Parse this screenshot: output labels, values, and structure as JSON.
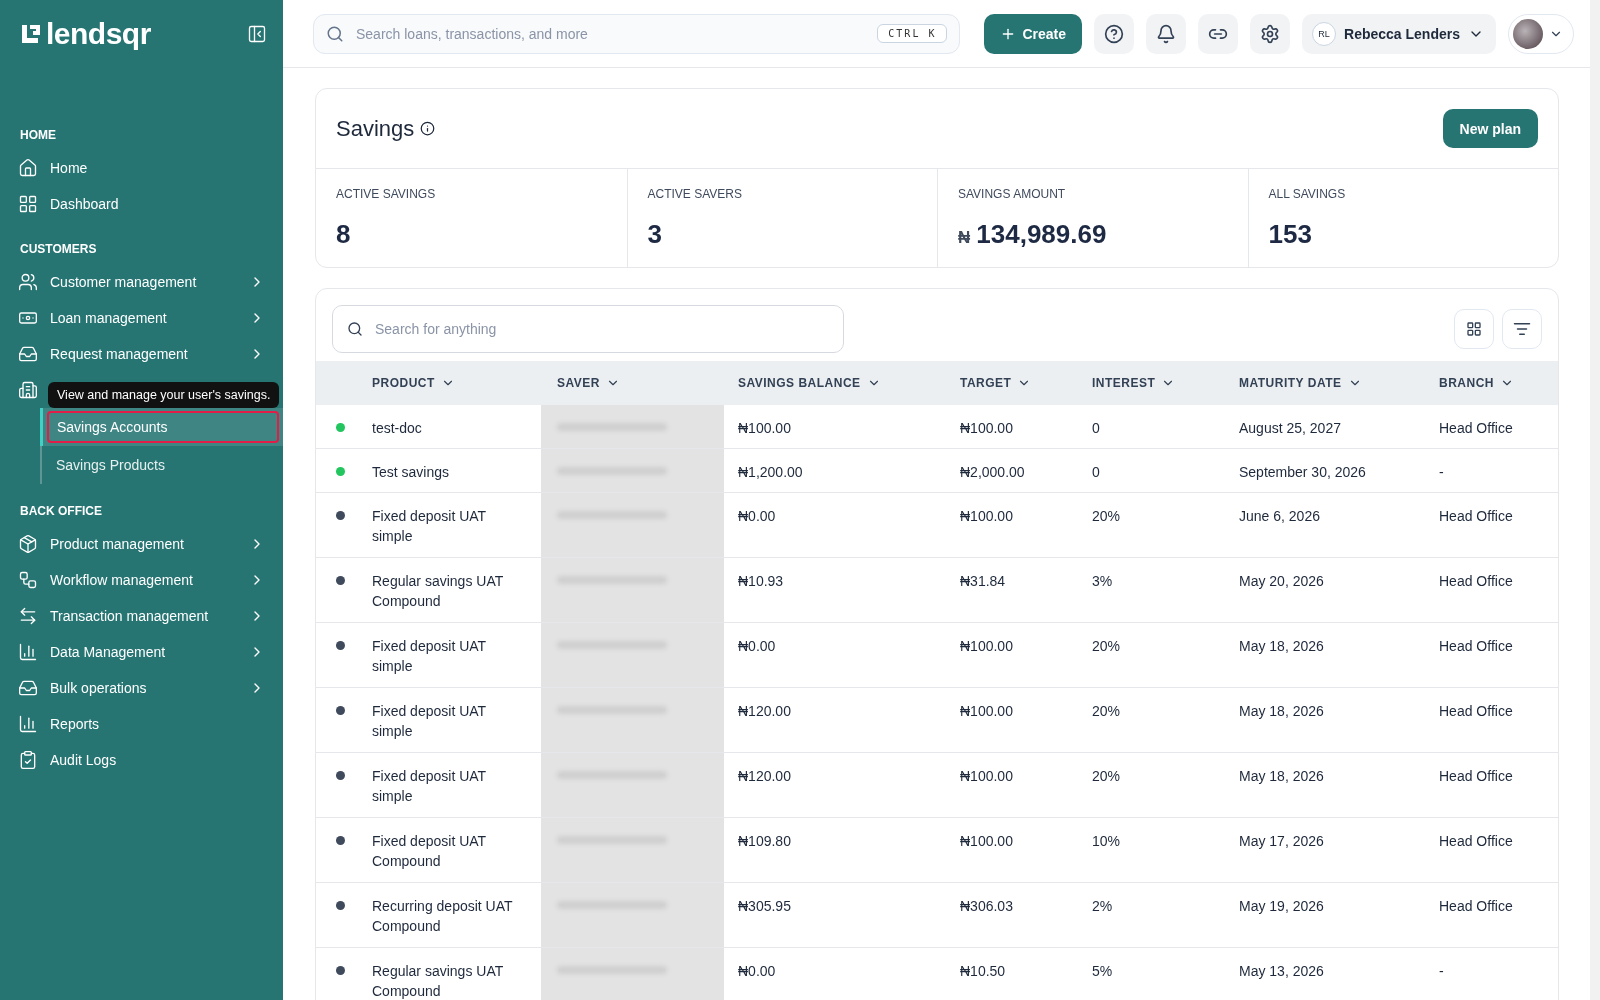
{
  "sidebar": {
    "logo": "lendsqr",
    "sections": [
      {
        "title": "HOME",
        "items": [
          {
            "label": "Home",
            "expandable": false
          },
          {
            "label": "Dashboard",
            "expandable": false
          }
        ]
      },
      {
        "title": "CUSTOMERS",
        "items": [
          {
            "label": "Customer management",
            "expandable": true
          },
          {
            "label": "Loan management",
            "expandable": true
          },
          {
            "label": "Request management",
            "expandable": true
          },
          {
            "tooltip": "View and manage your user's savings.",
            "children": [
              {
                "label": "Savings Accounts",
                "selected": true
              },
              {
                "label": "Savings Products",
                "selected": false
              }
            ]
          }
        ]
      },
      {
        "title": "BACK OFFICE",
        "items": [
          {
            "label": "Product management",
            "expandable": true
          },
          {
            "label": "Workflow management",
            "expandable": true
          },
          {
            "label": "Transaction management",
            "expandable": true
          },
          {
            "label": "Data Management",
            "expandable": true
          },
          {
            "label": "Bulk operations",
            "expandable": true
          },
          {
            "label": "Reports",
            "expandable": false
          },
          {
            "label": "Audit Logs",
            "expandable": false
          }
        ]
      }
    ]
  },
  "topbar": {
    "search": {
      "placeholder": "Search loans, transactions, and more",
      "shortcut": "CTRL K"
    },
    "create": "Create",
    "user": {
      "initials": "RL",
      "name": "Rebecca Lenders"
    }
  },
  "page": {
    "title": "Savings",
    "action": "New plan"
  },
  "stats": [
    {
      "label": "ACTIVE SAVINGS",
      "value": "8"
    },
    {
      "label": "ACTIVE SAVERS",
      "value": "3"
    },
    {
      "label": "SAVINGS AMOUNT",
      "currency": "₦",
      "value": "134,989.69"
    },
    {
      "label": "ALL SAVINGS",
      "value": "153"
    }
  ],
  "table": {
    "search": {
      "placeholder": "Search for anything"
    },
    "columns": [
      "PRODUCT",
      "SAVER",
      "SAVINGS BALANCE",
      "TARGET",
      "INTEREST",
      "MATURITY DATE",
      "BRANCH"
    ],
    "rows": [
      {
        "color": "#22c55e",
        "product": "test-doc",
        "balance": "₦100.00",
        "target": "₦100.00",
        "interest": "0",
        "maturity": "August 25, 2027",
        "branch": "Head Office"
      },
      {
        "color": "#22c55e",
        "product": "Test savings",
        "balance": "₦1,200.00",
        "target": "₦2,000.00",
        "interest": "0",
        "maturity": "September 30, 2026",
        "branch": "-"
      },
      {
        "color": "#3f4a5c",
        "product": "Fixed deposit UAT simple",
        "balance": "₦0.00",
        "target": "₦100.00",
        "interest": "20%",
        "maturity": "June 6, 2026",
        "branch": "Head Office"
      },
      {
        "color": "#3f4a5c",
        "product": "Regular savings UAT Compound",
        "balance": "₦10.93",
        "target": "₦31.84",
        "interest": "3%",
        "maturity": "May 20, 2026",
        "branch": "Head Office"
      },
      {
        "color": "#3f4a5c",
        "product": "Fixed deposit UAT simple",
        "balance": "₦0.00",
        "target": "₦100.00",
        "interest": "20%",
        "maturity": "May 18, 2026",
        "branch": "Head Office"
      },
      {
        "color": "#3f4a5c",
        "product": "Fixed deposit UAT simple",
        "balance": "₦120.00",
        "target": "₦100.00",
        "interest": "20%",
        "maturity": "May 18, 2026",
        "branch": "Head Office"
      },
      {
        "color": "#3f4a5c",
        "product": "Fixed deposit UAT simple",
        "balance": "₦120.00",
        "target": "₦100.00",
        "interest": "20%",
        "maturity": "May 18, 2026",
        "branch": "Head Office"
      },
      {
        "color": "#3f4a5c",
        "product": "Fixed deposit UAT Compound",
        "balance": "₦109.80",
        "target": "₦100.00",
        "interest": "10%",
        "maturity": "May 17, 2026",
        "branch": "Head Office"
      },
      {
        "color": "#3f4a5c",
        "product": "Recurring deposit UAT Compound",
        "balance": "₦305.95",
        "target": "₦306.03",
        "interest": "2%",
        "maturity": "May 19, 2026",
        "branch": "Head Office"
      },
      {
        "color": "#3f4a5c",
        "product": "Regular savings UAT Compound",
        "balance": "₦0.00",
        "target": "₦10.50",
        "interest": "5%",
        "maturity": "May 13, 2026",
        "branch": "-"
      }
    ]
  }
}
